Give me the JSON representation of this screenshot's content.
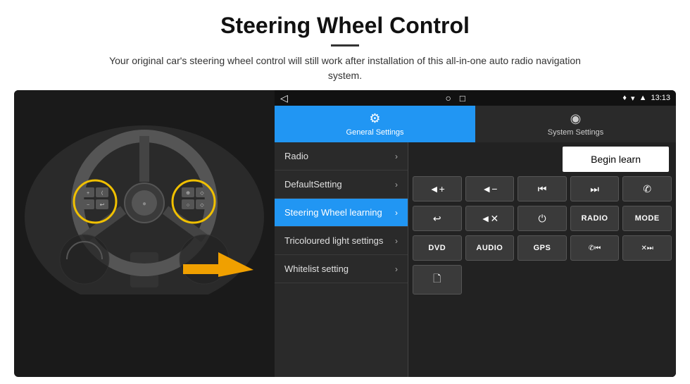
{
  "header": {
    "title": "Steering Wheel Control",
    "divider": true,
    "subtitle": "Your original car's steering wheel control will still work after installation of this all-in-one auto radio navigation system."
  },
  "status_bar": {
    "back": "◁",
    "home": "○",
    "recents": "□",
    "menu": "≡",
    "location_icon": "♦",
    "wifi_icon": "▾",
    "signal_icon": "▲",
    "time": "13:13"
  },
  "tabs": [
    {
      "id": "general",
      "label": "General Settings",
      "active": true,
      "icon": "⚙"
    },
    {
      "id": "system",
      "label": "System Settings",
      "active": false,
      "icon": "◉"
    }
  ],
  "menu_items": [
    {
      "id": "radio",
      "label": "Radio",
      "active": false
    },
    {
      "id": "default",
      "label": "DefaultSetting",
      "active": false
    },
    {
      "id": "steering",
      "label": "Steering Wheel learning",
      "active": true
    },
    {
      "id": "tricoloured",
      "label": "Tricoloured light settings",
      "active": false
    },
    {
      "id": "whitelist",
      "label": "Whitelist setting",
      "active": false
    }
  ],
  "begin_learn_label": "Begin learn",
  "control_buttons": [
    [
      {
        "id": "vol_up",
        "label": "◄+",
        "type": "icon"
      },
      {
        "id": "vol_down",
        "label": "◄−",
        "type": "icon"
      },
      {
        "id": "prev_track",
        "label": "◀◀",
        "type": "icon"
      },
      {
        "id": "next_track",
        "label": "▶▶",
        "type": "icon"
      },
      {
        "id": "phone",
        "label": "✆",
        "type": "icon"
      }
    ],
    [
      {
        "id": "hook",
        "label": "↩",
        "type": "icon"
      },
      {
        "id": "mute",
        "label": "◄✕",
        "type": "icon"
      },
      {
        "id": "power",
        "label": "⏻",
        "type": "icon"
      },
      {
        "id": "radio_btn",
        "label": "RADIO",
        "type": "text"
      },
      {
        "id": "mode_btn",
        "label": "MODE",
        "type": "text"
      }
    ],
    [
      {
        "id": "dvd_btn",
        "label": "DVD",
        "type": "text"
      },
      {
        "id": "audio_btn",
        "label": "AUDIO",
        "type": "text"
      },
      {
        "id": "gps_btn",
        "label": "GPS",
        "type": "text"
      },
      {
        "id": "tel_prev",
        "label": "✆◀◀",
        "type": "icon"
      },
      {
        "id": "tel_next",
        "label": "✕▶▶",
        "type": "icon"
      }
    ]
  ],
  "whitelist_row": [
    {
      "id": "whitelist_icon",
      "label": "🖹",
      "type": "icon"
    }
  ]
}
